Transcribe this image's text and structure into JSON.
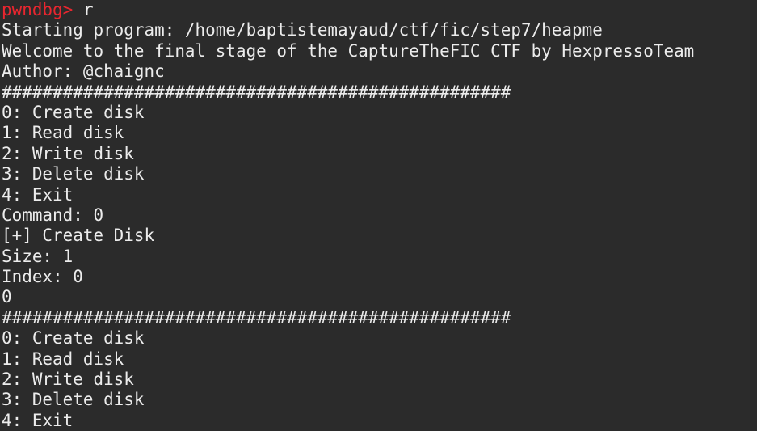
{
  "colors": {
    "background": "#2b2b2b",
    "foreground": "#ececec",
    "prompt": "#e8262f"
  },
  "prompt": {
    "label": "pwndbg>",
    "command": " r"
  },
  "lines": [
    "Starting program: /home/baptistemayaud/ctf/fic/step7/heapme",
    "Welcome to the final stage of the CaptureTheFIC CTF by HexpressoTeam",
    "Author: @chaignc",
    "##################################################",
    "0: Create disk",
    "1: Read disk",
    "2: Write disk",
    "3: Delete disk",
    "4: Exit",
    "Command: 0",
    "[+] Create Disk",
    "Size: 1",
    "Index: 0",
    "0",
    "##################################################",
    "0: Create disk",
    "1: Read disk",
    "2: Write disk",
    "3: Delete disk",
    "4: Exit"
  ]
}
